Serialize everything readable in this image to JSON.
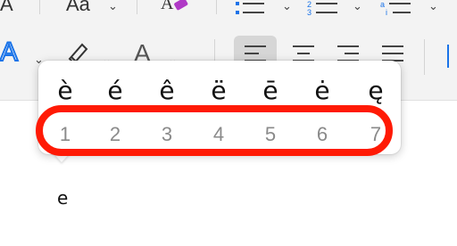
{
  "toolbar": {
    "font_glyph": "A",
    "change_case_label": "Aa",
    "font_color_glyph": "A",
    "text_effects_glyph": "A"
  },
  "accent_popup": {
    "accents": [
      "è",
      "é",
      "ê",
      "ë",
      "ē",
      "ė",
      "ę"
    ],
    "numbers": [
      "1",
      "2",
      "3",
      "4",
      "5",
      "6",
      "7"
    ]
  },
  "document": {
    "typed_char": "e"
  },
  "colors": {
    "highlight": "#ff1a05",
    "accent_blue": "#1a73e8",
    "eraser_purple": "#b03ac6"
  }
}
